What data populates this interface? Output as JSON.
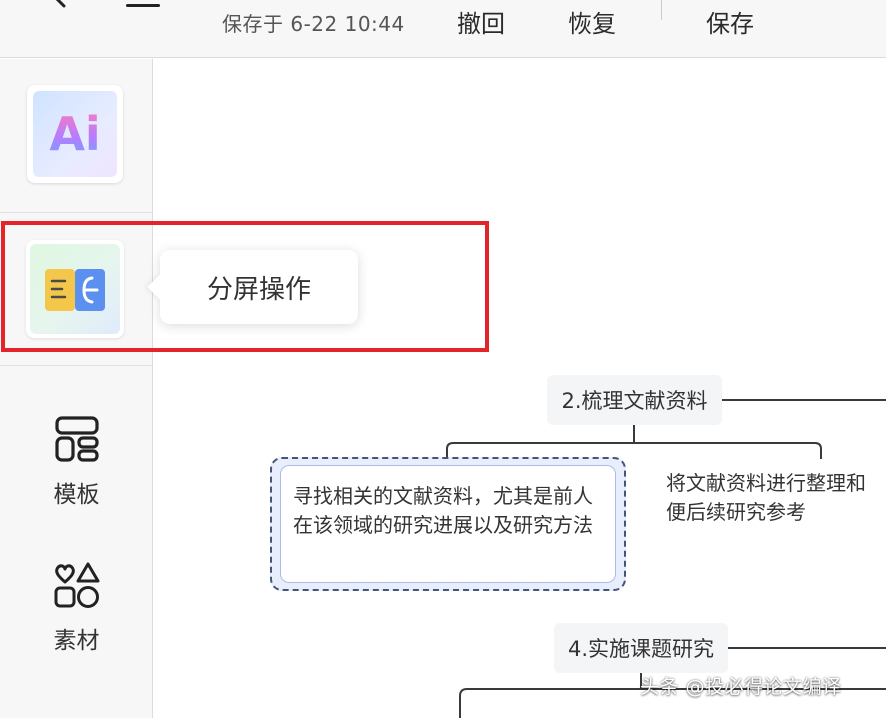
{
  "toolbar": {
    "save_status": "保存于 6-22 10:44",
    "undo_label": "撤回",
    "redo_label": "恢复",
    "save_label": "保存"
  },
  "sidebar": {
    "ai_label": "Ai",
    "items": [
      {
        "label": "模板",
        "icon": "template-icon"
      },
      {
        "label": "素材",
        "icon": "material-icon"
      }
    ]
  },
  "tooltip": {
    "text": "分屏操作"
  },
  "mindmap": {
    "node_2": "2.梳理文献资料",
    "node_2_child_1": "寻找相关的文献资料，尤其是前人在该领域的研究进展以及研究方法",
    "node_2_child_2_line1": "将文献资料进行整理和",
    "node_2_child_2_line2": "便后续研究参考",
    "node_4": "4.实施课题研究"
  },
  "watermark": {
    "text": "头条 @投必得论文编译"
  },
  "colors": {
    "highlight": "#e3242b",
    "selected_border": "#43557a",
    "selected_fill": "#e8eefb"
  }
}
